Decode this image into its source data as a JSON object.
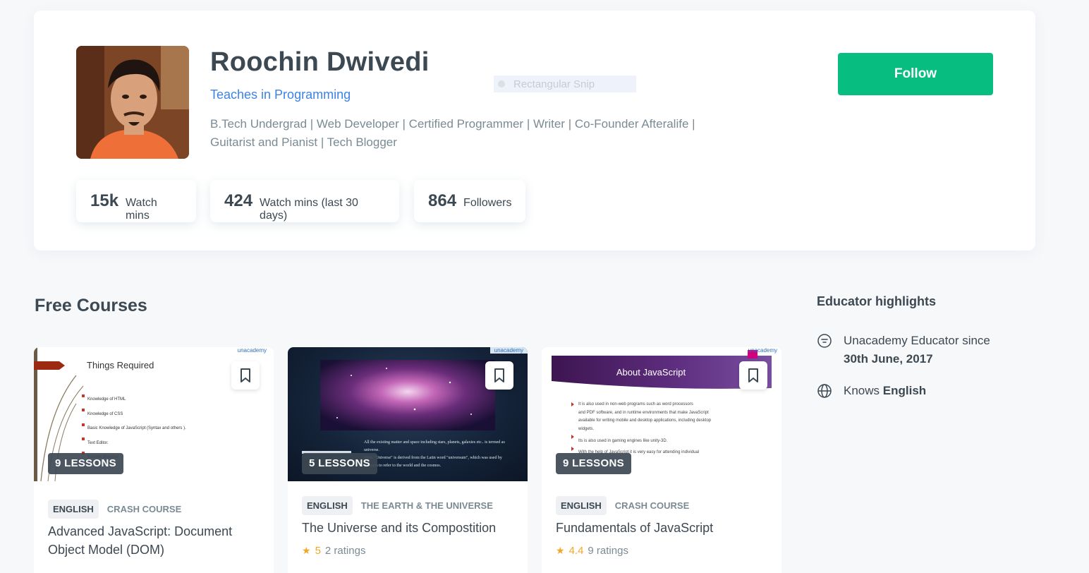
{
  "profile": {
    "name": "Roochin Dwivedi",
    "teaches": "Teaches in Programming",
    "bio_line1": "B.Tech Undergrad | Web Developer | Certified Programmer | Writer | Co-Founder Afteralife |",
    "bio_line2": "Guitarist and Pianist | Tech Blogger",
    "follow_label": "Follow",
    "snip_overlay": "Rectangular Snip",
    "stats": [
      {
        "value": "15k",
        "label": "Watch mins"
      },
      {
        "value": "424",
        "label": "Watch mins (last 30 days)"
      },
      {
        "value": "864",
        "label": "Followers"
      }
    ]
  },
  "courses": {
    "section_title": "Free Courses",
    "items": [
      {
        "lessons": "9 LESSONS",
        "language": "ENGLISH",
        "topic": "CRASH COURSE",
        "title": "Advanced JavaScript: Document Object Model (DOM)",
        "thumb": {
          "brand": "unacademy",
          "heading": "Things Required",
          "bullets": [
            "Knowledge of HTML",
            "Knowledge of CSS",
            "Basic Knowledge of JavaScript (Syntax and others ).",
            "Text Editor.",
            "Internet Browser."
          ]
        }
      },
      {
        "lessons": "5 LESSONS",
        "language": "ENGLISH",
        "topic": "THE EARTH & THE UNIVERSE",
        "title": "The Universe and its Compostition",
        "rating": "5",
        "ratings_count": "2 ratings",
        "thumb": {
          "brand": "unacademy",
          "bullets": [
            "All the existing matter and space including stars, planets, galaxies etc.. is termed as universe.",
            "Term \"Universe\" is derived from the Latin word \"universum\", which was used by Romans to refer to the world and the cosmos."
          ]
        }
      },
      {
        "lessons": "9 LESSONS",
        "language": "ENGLISH",
        "topic": "CRASH COURSE",
        "title": "Fundamentals of JavaScript",
        "rating": "4.4",
        "ratings_count": "9 ratings",
        "thumb": {
          "brand": "unacademy",
          "heading": "About JavaScript",
          "bullets": [
            "It is also used in non-web programs such as word processors",
            "and PDF software, and in runtime environments that make JavaScript",
            "available for writing mobile and desktop applications, including desktop",
            "widgets.",
            "Its is also used in gaming engines like unity-3D.",
            "With the help of JavaScript it is very easy for attending individual"
          ]
        }
      }
    ]
  },
  "highlights": {
    "title": "Educator highlights",
    "since_prefix": "Unacademy Educator since",
    "since_date": "30th June, 2017",
    "knows_prefix": "Knows",
    "knows_lang": "English"
  },
  "colors": {
    "accent_green": "#08bd80",
    "link_blue": "#3c83e5",
    "star": "#f5a623"
  }
}
